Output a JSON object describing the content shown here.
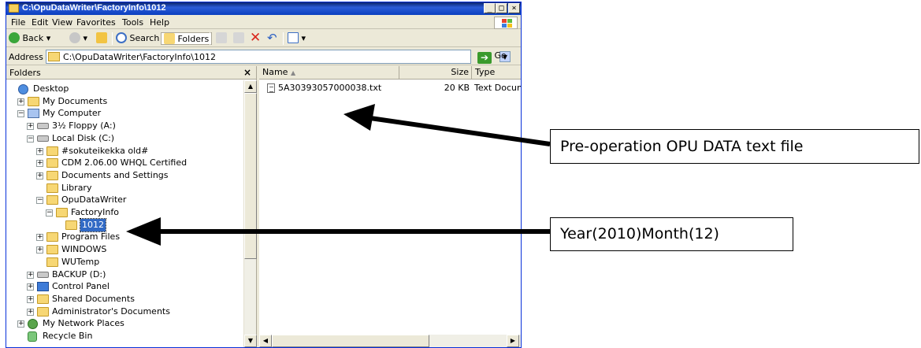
{
  "window": {
    "title": "C:\\OpuDataWriter\\FactoryInfo\\1012",
    "controls": {
      "minimize": "_",
      "maximize": "□",
      "close": "×"
    }
  },
  "menu": [
    "File",
    "Edit",
    "View",
    "Favorites",
    "Tools",
    "Help"
  ],
  "toolbar": {
    "back": "Back",
    "search": "Search",
    "folders": "Folders"
  },
  "address": {
    "label": "Address",
    "value": "C:\\OpuDataWriter\\FactoryInfo\\1012",
    "go": "Go"
  },
  "folders_pane": {
    "title": "Folders",
    "close": "×",
    "tree": [
      {
        "label": "Desktop",
        "icon": "desktop-icon",
        "expander": ""
      },
      {
        "label": "My Documents",
        "icon": "folder-icon",
        "expander": "+"
      },
      {
        "label": "My Computer",
        "icon": "computer-icon",
        "expander": "−"
      },
      {
        "label": "3½ Floppy (A:)",
        "icon": "floppy-icon",
        "expander": "+"
      },
      {
        "label": "Local Disk (C:)",
        "icon": "drive-icon",
        "expander": "−"
      },
      {
        "label": "#sokuteikekka old#",
        "icon": "folder-icon",
        "expander": "+"
      },
      {
        "label": "CDM 2.06.00 WHQL Certified",
        "icon": "folder-icon",
        "expander": "+"
      },
      {
        "label": "Documents and Settings",
        "icon": "folder-icon",
        "expander": "+"
      },
      {
        "label": "Library",
        "icon": "folder-icon",
        "expander": ""
      },
      {
        "label": "OpuDataWriter",
        "icon": "folder-icon",
        "expander": "−"
      },
      {
        "label": "FactoryInfo",
        "icon": "folder-icon",
        "expander": "−"
      },
      {
        "label": "1012",
        "icon": "open-folder-icon",
        "expander": "",
        "selected": true
      },
      {
        "label": "Program Files",
        "icon": "folder-icon",
        "expander": "+"
      },
      {
        "label": "WINDOWS",
        "icon": "folder-icon",
        "expander": "+"
      },
      {
        "label": "WUTemp",
        "icon": "folder-icon",
        "expander": ""
      },
      {
        "label": "BACKUP (D:)",
        "icon": "drive-icon",
        "expander": "+"
      },
      {
        "label": "Control Panel",
        "icon": "control-panel-icon",
        "expander": "+"
      },
      {
        "label": "Shared Documents",
        "icon": "folder-icon",
        "expander": "+"
      },
      {
        "label": "Administrator's Documents",
        "icon": "folder-icon",
        "expander": "+"
      },
      {
        "label": "My Network Places",
        "icon": "network-icon",
        "expander": "+"
      },
      {
        "label": "Recycle Bin",
        "icon": "recycle-bin-icon",
        "expander": ""
      }
    ]
  },
  "file_list": {
    "columns": {
      "name": "Name",
      "size": "Size",
      "type": "Type"
    },
    "files": [
      {
        "name": "5A30393057000038.txt",
        "size": "20 KB",
        "type": "Text Docun"
      }
    ]
  },
  "callouts": {
    "file": "Pre-operation OPU DATA text file",
    "folder": "Year(2010)Month(12)"
  }
}
